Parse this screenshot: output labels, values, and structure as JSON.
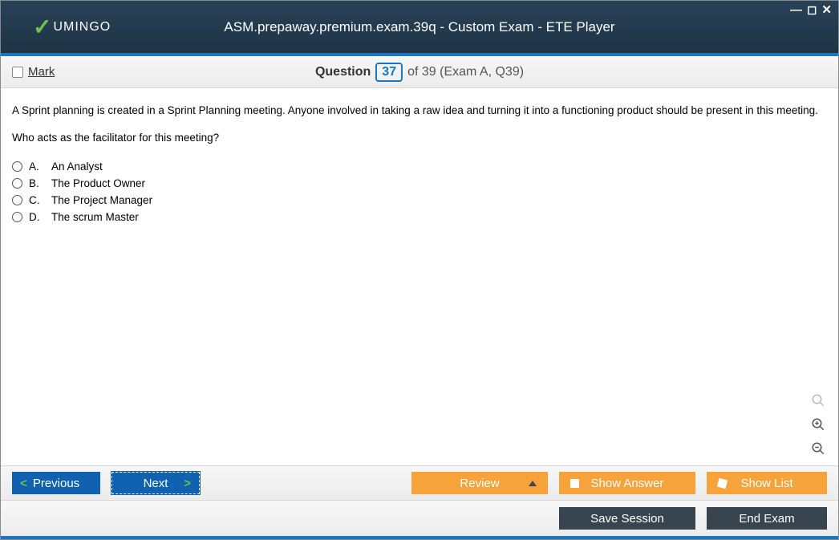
{
  "window": {
    "logo_text": "UMINGO",
    "title": "ASM.prepaway.premium.exam.39q - Custom Exam - ETE Player"
  },
  "header": {
    "mark_label": "Mark",
    "question_label": "Question",
    "current_num": "37",
    "of_text": "of 39 (Exam A, Q39)"
  },
  "question": {
    "paragraph1": "A Sprint planning is created in a Sprint Planning meeting. Anyone involved in taking a raw idea and turning it into a functioning product should be present in this meeting.",
    "paragraph2": "Who acts as the facilitator for this meeting?",
    "options": [
      {
        "letter": "A.",
        "text": "An Analyst"
      },
      {
        "letter": "B.",
        "text": "The Product Owner"
      },
      {
        "letter": "C.",
        "text": "The Project Manager"
      },
      {
        "letter": "D.",
        "text": "The scrum Master"
      }
    ]
  },
  "buttons": {
    "previous": "Previous",
    "next": "Next",
    "review": "Review",
    "show_answer": "Show Answer",
    "show_list": "Show List",
    "save_session": "Save Session",
    "end_exam": "End Exam"
  }
}
